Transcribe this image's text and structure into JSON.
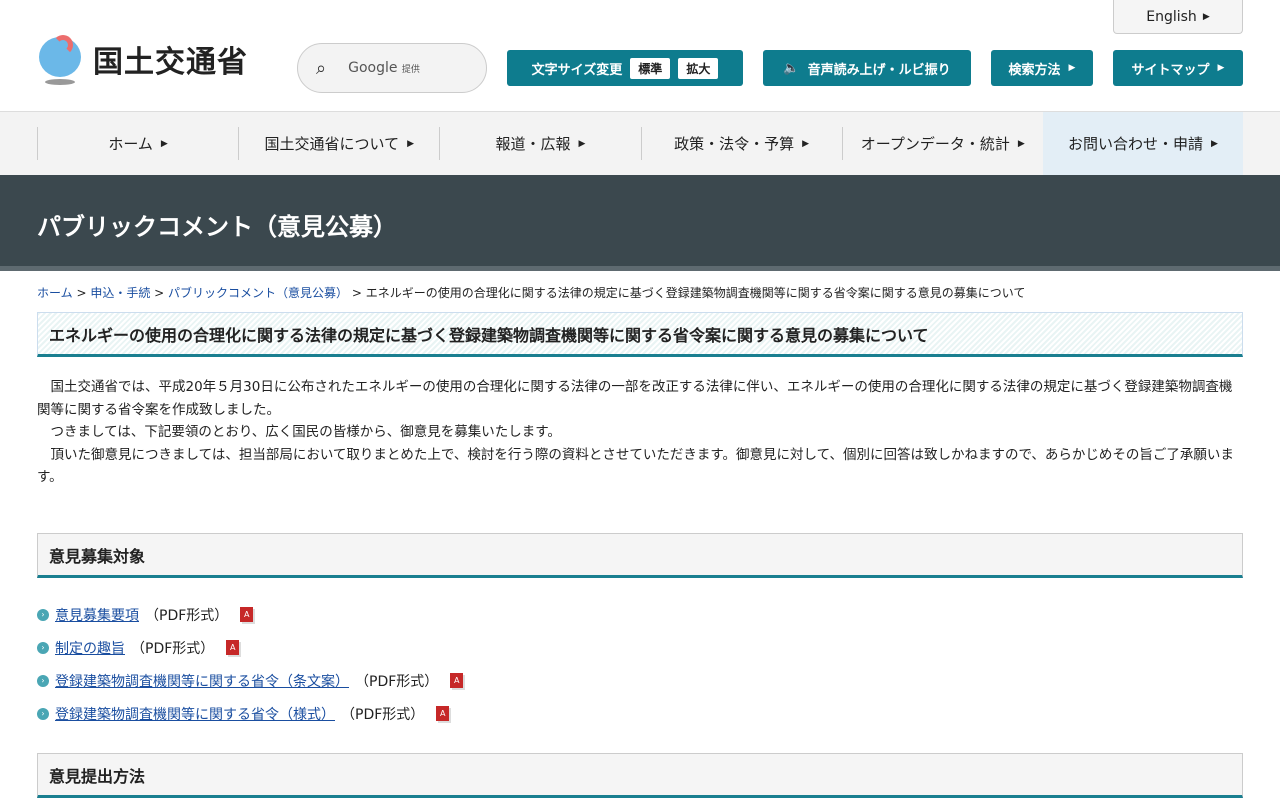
{
  "header": {
    "english": "English",
    "logo_text": "国土交通省",
    "search_brand": "Google",
    "search_suffix": "提供",
    "font_size_label": "文字サイズ変更",
    "font_std": "標準",
    "font_large": "拡大",
    "voice": "音声読み上げ・ルビ振り",
    "search_method": "検索方法",
    "sitemap": "サイトマップ"
  },
  "nav": [
    "ホーム",
    "国土交通省について",
    "報道・広報",
    "政策・法令・予算",
    "オープンデータ・統計",
    "お問い合わせ・申請"
  ],
  "banner": "パブリックコメント（意見公募）",
  "breadcrumb": {
    "links": [
      "ホーム",
      "申込・手続",
      "パブリックコメント（意見公募）"
    ],
    "current": "エネルギーの使用の合理化に関する法律の規定に基づく登録建築物調査機関等に関する省令案に関する意見の募集について"
  },
  "title": "エネルギーの使用の合理化に関する法律の規定に基づく登録建築物調査機関等に関する省令案に関する意見の募集について",
  "paragraphs": [
    "　国土交通省では、平成20年５月30日に公布されたエネルギーの使用の合理化に関する法律の一部を改正する法律に伴い、エネルギーの使用の合理化に関する法律の規定に基づく登録建築物調査機関等に関する省令案を作成致しました。",
    "　つきましては、下記要領のとおり、広く国民の皆様から、御意見を募集いたします。",
    "　頂いた御意見につきましては、担当部局において取りまとめた上で、検討を行う際の資料とさせていただきます。御意見に対して、個別に回答は致しかねますので、あらかじめその旨ご了承願います。"
  ],
  "section1": "意見募集対象",
  "links": [
    {
      "text": "意見募集要項",
      "suffix": "（PDF形式）"
    },
    {
      "text": "制定の趣旨",
      "suffix": "（PDF形式）"
    },
    {
      "text": "登録建築物調査機関等に関する省令（条文案）",
      "suffix": "（PDF形式）"
    },
    {
      "text": "登録建築物調査機関等に関する省令（様式）",
      "suffix": "（PDF形式）"
    }
  ],
  "section2": "意見提出方法"
}
